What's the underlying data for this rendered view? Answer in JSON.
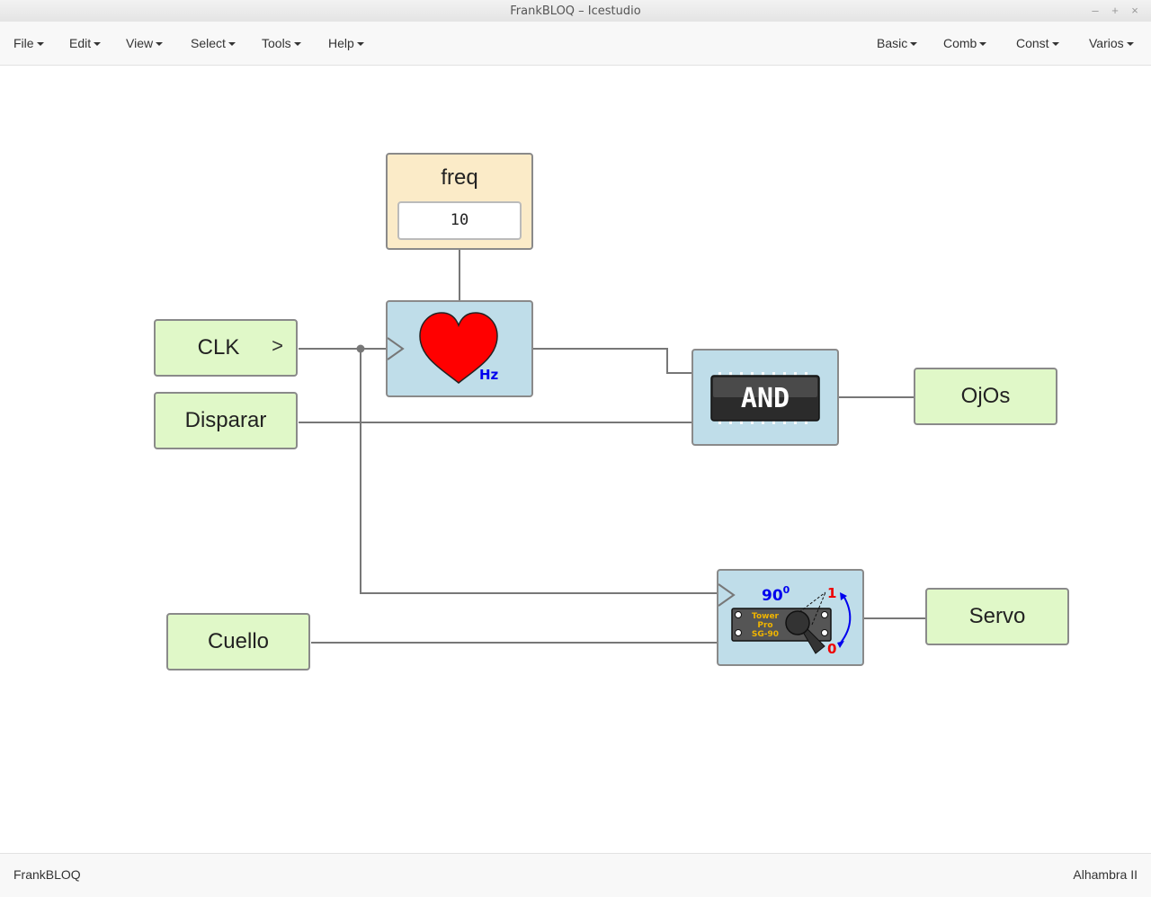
{
  "window": {
    "title": "FrankBLOQ – Icestudio",
    "minimize": "–",
    "maximize": "+",
    "close": "×"
  },
  "menubar": {
    "left": [
      "File",
      "Edit",
      "View",
      "Select",
      "Tools",
      "Help"
    ],
    "right": [
      "Basic",
      "Comb",
      "Const",
      "Varios"
    ]
  },
  "blocks": {
    "freq": {
      "name": "freq",
      "value": "10"
    },
    "clk": {
      "label": "CLK",
      "clock_symbol": ">"
    },
    "disparar": {
      "label": "Disparar"
    },
    "ojos": {
      "label": "OjOs"
    },
    "cuello": {
      "label": "Cuello"
    },
    "servo_out": {
      "label": "Servo"
    },
    "heart": {
      "icon": "heart-icon",
      "unit": "Hz",
      "color": "#ff0000",
      "unit_color": "#0000ee"
    },
    "and": {
      "icon": "and-chip-icon",
      "label": "AND"
    },
    "servo": {
      "icon": "servo-motor-icon",
      "angle": "90",
      "degree": "0",
      "high": "1",
      "low": "0",
      "brand_line1": "Tower",
      "brand_line2": "Pro",
      "brand_line3": "SG-90"
    }
  },
  "statusbar": {
    "left": "FrankBLOQ",
    "right": "Alhambra II"
  },
  "colors": {
    "io_block": "#e0f8c8",
    "logic_block": "#bfdde9",
    "const_block": "#fbebc8",
    "wire": "#777777"
  }
}
